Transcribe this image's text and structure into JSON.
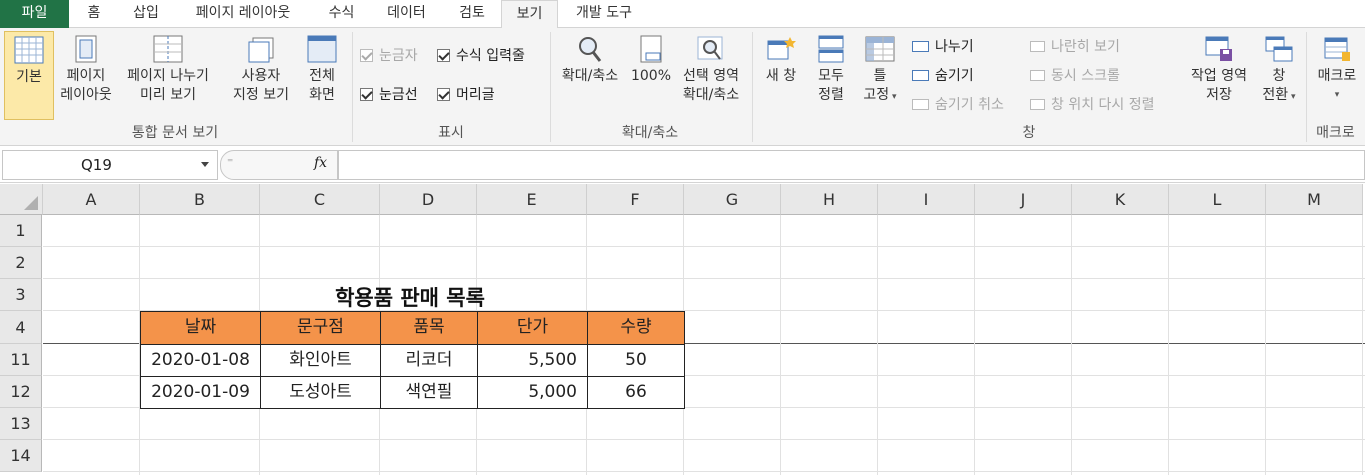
{
  "tabs": [
    "파일",
    "홈",
    "삽입",
    "페이지 레이아웃",
    "수식",
    "데이터",
    "검토",
    "보기",
    "개발 도구"
  ],
  "ribbon": {
    "workbook_views": {
      "normal": "기본",
      "page_layout_1": "페이지",
      "page_layout_2": "레이아웃",
      "page_break_1": "페이지 나누기",
      "page_break_2": "미리 보기",
      "custom_1": "사용자",
      "custom_2": "지정 보기",
      "full_1": "전체",
      "full_2": "화면",
      "group": "통합 문서 보기"
    },
    "show": {
      "ruler": "눈금자",
      "formula_bar": "수식 입력줄",
      "gridlines": "눈금선",
      "headings": "머리글",
      "group": "표시"
    },
    "zoom": {
      "zoom": "확대/축소",
      "hundred": "100%",
      "sel_1": "선택 영역",
      "sel_2": "확대/축소",
      "group": "확대/축소"
    },
    "window": {
      "new_window": "새 창",
      "arrange_1": "모두",
      "arrange_2": "정렬",
      "freeze_1": "틀",
      "freeze_2": "고정",
      "split": "나누기",
      "hide": "숨기기",
      "unhide": "숨기기 취소",
      "side": "나란히 보기",
      "sync": "동시 스크롤",
      "reset": "창 위치 다시 정렬",
      "save_ws_1": "작업 영역",
      "save_ws_2": "저장",
      "switch_1": "창",
      "switch_2": "전환",
      "group": "창"
    },
    "macros": {
      "label": "매크로",
      "group": "매크로"
    }
  },
  "formula_bar": {
    "name_box": "Q19",
    "fx": "fx",
    "value": ""
  },
  "columns": [
    "A",
    "B",
    "C",
    "D",
    "E",
    "F",
    "G",
    "H",
    "I",
    "J",
    "K",
    "L",
    "M"
  ],
  "rows": [
    "1",
    "2",
    "3",
    "4",
    "11",
    "12",
    "13",
    "14"
  ],
  "sheet": {
    "title": "학용품 판매 목록",
    "headers": [
      "날짜",
      "문구점",
      "품목",
      "단가",
      "수량"
    ],
    "data": [
      [
        "2020-01-08",
        "화인아트",
        "리코더",
        "5,500",
        "50"
      ],
      [
        "2020-01-09",
        "도성아트",
        "색연필",
        "5,000",
        "66"
      ]
    ]
  },
  "colors": {
    "excel_green": "#217346",
    "header_fill": "#f4934a"
  }
}
